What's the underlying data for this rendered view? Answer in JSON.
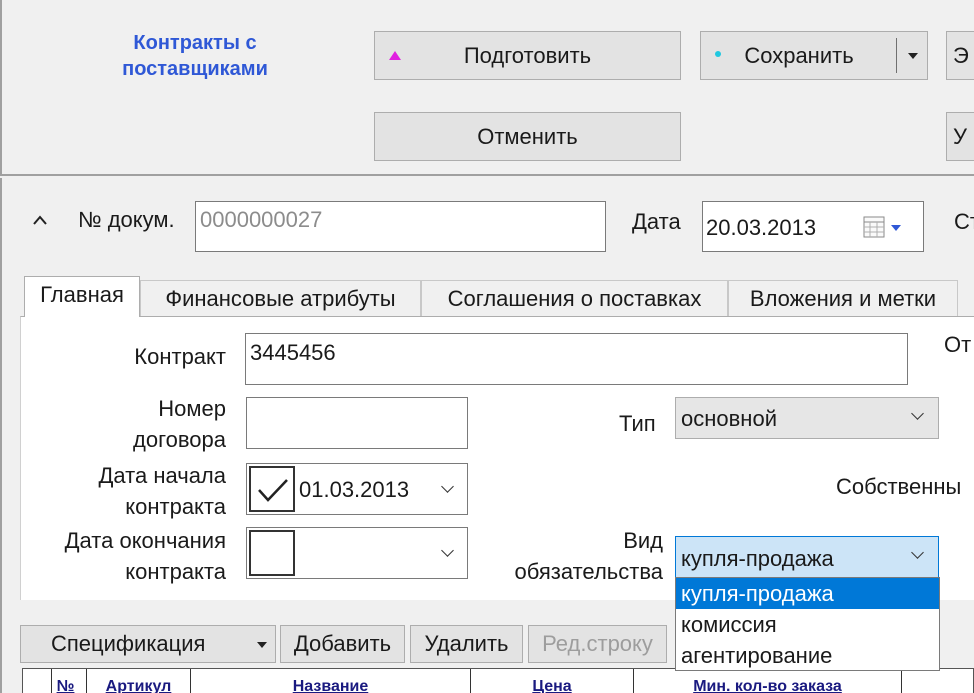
{
  "app": {
    "title": "Контракты с поставщиками"
  },
  "toolbar": {
    "prepare_label": "Подготовить",
    "save_label": "Сохранить",
    "cancel_label": "Отменить",
    "right_top_partial": "Э",
    "right_bottom_partial": "У"
  },
  "header": {
    "collapse_glyph": "^",
    "doc_number_label": "№ докум.",
    "doc_number_value": "0000000027",
    "date_label": "Дата",
    "date_value": "20.03.2013",
    "status_partial": "Ст"
  },
  "tabs": [
    {
      "label": "Главная",
      "active": true
    },
    {
      "label": "Финансовые атрибуты",
      "active": false
    },
    {
      "label": "Соглашения о поставках",
      "active": false
    },
    {
      "label": "Вложения и метки",
      "active": false
    }
  ],
  "form": {
    "contract_label": "Контракт",
    "contract_value": "3445456",
    "right_partial_label": "От",
    "agreement_no_label_1": "Номер",
    "agreement_no_label_2": "договора",
    "agreement_no_value": "",
    "type_label": "Тип",
    "type_value": "основной",
    "start_date_label_1": "Дата начала",
    "start_date_label_2": "контракта",
    "start_date_checked": true,
    "start_date_value": "01.03.2013",
    "own_partial_label": "Собственны",
    "end_date_label_1": "Дата окончания",
    "end_date_label_2": "контракта",
    "end_date_checked": false,
    "end_date_value": "",
    "obligation_label_1": "Вид",
    "obligation_label_2": "обязательства",
    "obligation_value": "купля-продажа",
    "obligation_options": [
      "купля-продажа",
      "комиссия",
      "агентирование"
    ],
    "obligation_selected_index": 0
  },
  "spec_toolbar": {
    "spec_label": "Спецификация",
    "add_label": "Добавить",
    "delete_label": "Удалить",
    "edit_row_label": "Ред.строку"
  },
  "grid": {
    "columns": [
      "№",
      "Артикул",
      "Название",
      "Цена",
      "Мин. кол-во заказа"
    ]
  },
  "colors": {
    "title_blue": "#2f58d6",
    "selection_blue": "#0078d7",
    "prepare_marker": "#e020e0",
    "save_marker": "#20c8e0"
  }
}
